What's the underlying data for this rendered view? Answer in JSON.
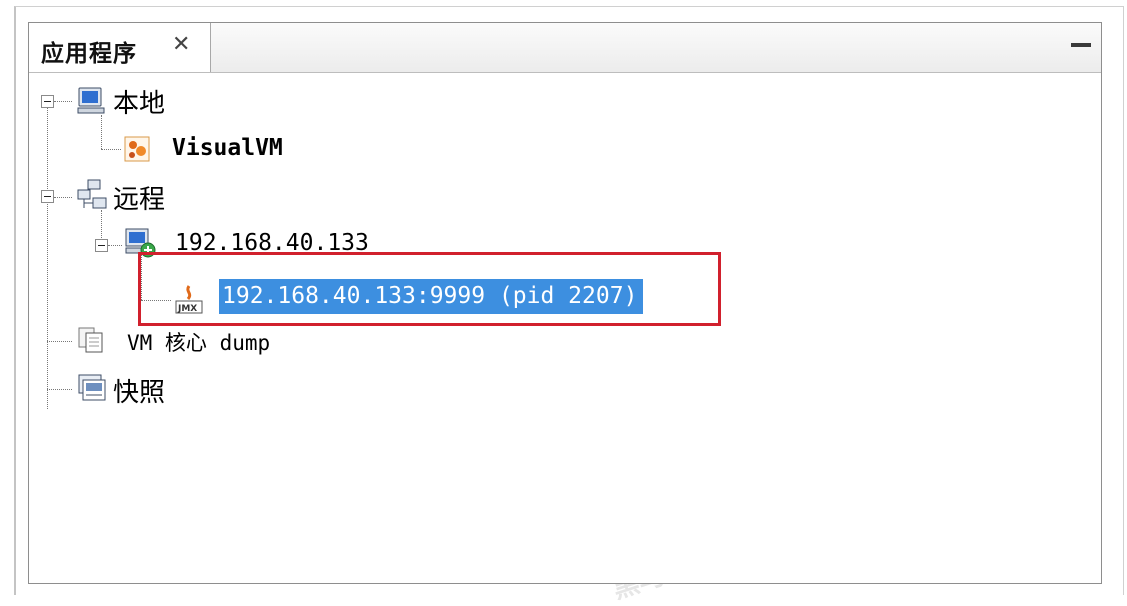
{
  "panel": {
    "tab_label": "应用程序",
    "tab_close": "✕",
    "minimize_icon": "minimize-icon"
  },
  "tree": {
    "local": {
      "label": "本地",
      "icon": "computer-icon"
    },
    "visualvm": {
      "label": "VisualVM",
      "icon": "visualvm-app-icon"
    },
    "remote": {
      "label": "远程",
      "icon": "network-hosts-icon"
    },
    "host": {
      "label": "192.168.40.133",
      "icon": "remote-host-icon"
    },
    "jmx": {
      "label": "192.168.40.133:9999 (pid 2207)",
      "icon": "jmx-connection-icon",
      "selected": true
    },
    "coredump": {
      "label": "VM 核心 dump",
      "icon": "core-dump-icon"
    },
    "snapshots": {
      "label": "快照",
      "icon": "snapshot-icon"
    }
  },
  "watermark": "黑马程序员",
  "colors": {
    "selection": "#3d8fe0",
    "highlight_box": "#d1202d"
  }
}
